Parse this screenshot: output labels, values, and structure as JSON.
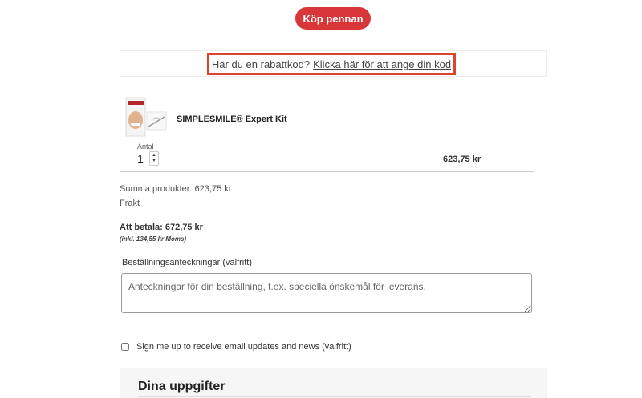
{
  "buy_button": {
    "label": "Köp pennan"
  },
  "coupon": {
    "prompt": "Har du en rabattkod?",
    "link": "Klicka här för att ange din kod"
  },
  "product": {
    "image_icon": "product-box-image",
    "name": "SIMPLESMILE® Expert Kit",
    "quantity_label": "Antal",
    "quantity": "1",
    "price": "623,75 kr"
  },
  "summary": {
    "products_total": "Summa produkter: 623,75 kr",
    "shipping": "Frakt",
    "to_pay": "Att betala: 672,75 kr",
    "vat_note": "(inkl. 134,55 kr Moms)"
  },
  "notes": {
    "label": "Beställningsanteckningar (valfritt)",
    "placeholder": "Anteckningar för din beställning, t.ex. speciella önskemål för leverans."
  },
  "newsletter": {
    "label": "Sign me up to receive email updates and news (valfritt)"
  },
  "details": {
    "title": "Dina uppgifter"
  },
  "colors": {
    "accent": "#d9363a",
    "highlight_border": "#d9442f"
  }
}
